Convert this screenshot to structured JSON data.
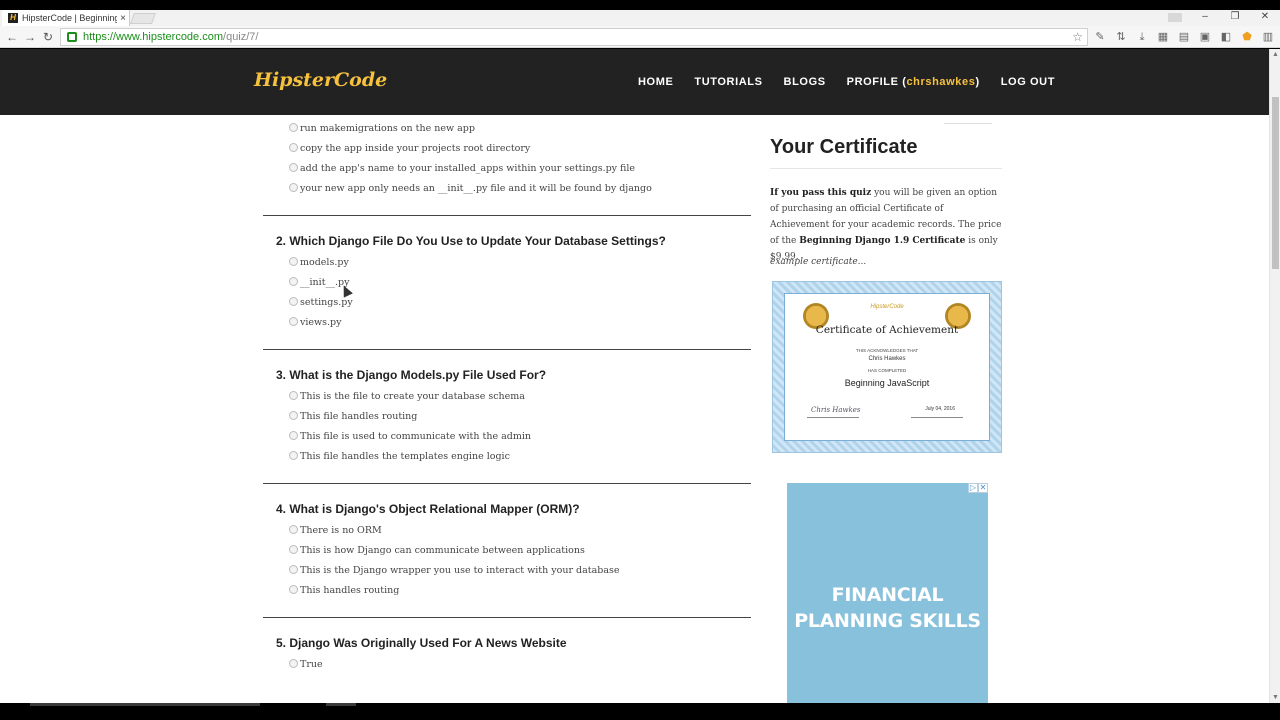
{
  "browser": {
    "tab_title": "HipsterCode | Beginning",
    "tab_close": "×",
    "window_controls": [
      "–",
      "❐",
      "✕"
    ],
    "url_host": "https://www.hipstercode.com",
    "url_path": "/quiz/7/",
    "ext_icons": [
      "pen-icon",
      "arrows-icon",
      "download-icon",
      "app-icon",
      "app-icon",
      "app-icon",
      "app-icon",
      "pentagon-icon",
      "app-icon",
      "menu-icon"
    ]
  },
  "site": {
    "logo": "HipsterCode",
    "nav": {
      "home": "HOME",
      "tutorials": "TUTORIALS",
      "blogs": "BLOGS",
      "profile_prefix": "PROFILE (",
      "username": "chrshawkes",
      "profile_suffix": ")",
      "logout": "LOG OUT"
    },
    "accent_color": "#f6c23e"
  },
  "quiz": {
    "q1_options": [
      "run makemigrations on the new app",
      "copy the app inside your projects root directory",
      "add the app's name to your installed_apps within your settings.py file",
      "your new app only needs an __init__.py file and it will be found by django"
    ],
    "questions": [
      {
        "title": "2. Which Django File Do You Use to Update Your Database Settings?",
        "options": [
          "models.py",
          "__init__.py",
          "settings.py",
          "views.py"
        ]
      },
      {
        "title": "3. What is the Django Models.py File Used For?",
        "options": [
          "This is the file to create your database schema",
          "This file handles routing",
          "This file is used to communicate with the admin",
          "This file handles the templates engine logic"
        ]
      },
      {
        "title": "4. What is Django's Object Relational Mapper (ORM)?",
        "options": [
          "There is no ORM",
          "This is how Django can communicate between applications",
          "This is the Django wrapper you use to interact with your database",
          "This handles routing"
        ]
      },
      {
        "title": "5. Django Was Originally Used For A News Website",
        "options": [
          "True"
        ]
      }
    ]
  },
  "sidebar": {
    "title": "Your Certificate",
    "text_bold1": "If you pass this quiz",
    "text_mid": " you will be given an option of purchasing an official Certificate of Achievement for your academic records. The price of the ",
    "text_bold2": "Beginning Django 1.9 Certificate",
    "text_end": " is only $9.99.",
    "example_label": "example certificate...",
    "certificate": {
      "brand": "HipsterCode",
      "title": "Certificate of Achievement",
      "ack": "THIS ACKNOWLEDGES THAT",
      "name": "Chris Hawkes",
      "completed": "HAS COMPLETED",
      "course": "Beginning JavaScript",
      "signature": "Chris Hawkes",
      "date": "July 04, 2016"
    },
    "ad": {
      "text_line1": "FINANCIAL",
      "text_line2": "PLANNING SKILLS",
      "ad_icons": [
        "▷",
        "✕"
      ]
    }
  }
}
